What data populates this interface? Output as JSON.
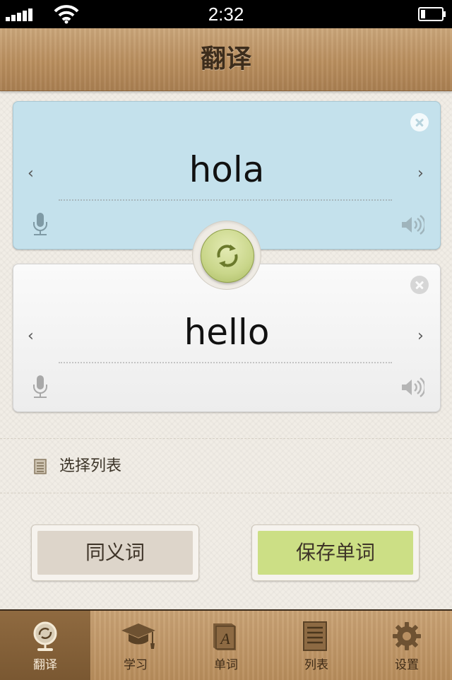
{
  "status_bar": {
    "time": "2:32"
  },
  "nav": {
    "title": "翻译"
  },
  "source": {
    "word": "hola"
  },
  "target": {
    "word": "hello"
  },
  "list_selector": {
    "label": "选择列表"
  },
  "actions": {
    "synonym": "同义词",
    "save": "保存单词"
  },
  "tabs": [
    {
      "label": "翻译",
      "icon": "globe-swap-icon",
      "active": true
    },
    {
      "label": "学习",
      "icon": "graduation-cap-icon",
      "active": false
    },
    {
      "label": "单词",
      "icon": "book-icon",
      "active": false
    },
    {
      "label": "列表",
      "icon": "list-icon",
      "active": false
    },
    {
      "label": "设置",
      "icon": "gear-icon",
      "active": false
    }
  ],
  "colors": {
    "source_card": "#c4e1ec",
    "swap_button": "#c9d68a",
    "save_button": "#ccdf85",
    "synonym_button": "#ddd5ca"
  }
}
